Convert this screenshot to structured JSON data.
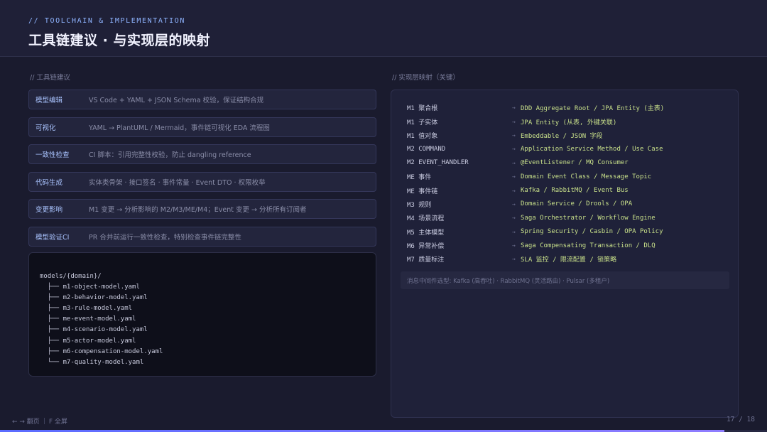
{
  "header": {
    "kicker": "// TOOLCHAIN & IMPLEMENTATION",
    "title": "工具链建议 · 与实现层的映射"
  },
  "left_section_label": "//  工具链建议",
  "right_section_label": "//  实现层映射（关键）",
  "tools": [
    {
      "name": "模型编辑",
      "desc": "VS Code + YAML + JSON Schema 校验，保证结构合规"
    },
    {
      "name": "可视化",
      "desc": "YAML → PlantUML / Mermaid，事件链可视化 EDA 流程图"
    },
    {
      "name": "一致性检查",
      "desc": "CI 脚本：引用完整性校验，防止 dangling reference"
    },
    {
      "name": "代码生成",
      "desc": "实体类骨架 · 接口签名 · 事件常量 · Event DTO · 权限枚举"
    },
    {
      "name": "变更影响",
      "desc": "M1 变更 → 分析影响的 M2/M3/ME/M4；Event 变更 → 分析所有订阅者"
    },
    {
      "name": "模型验证CI",
      "desc": "PR 合并前运行一致性检查，特别检查事件链完整性"
    }
  ],
  "code_lines": [
    "models/{domain}/",
    "  ├── m1-object-model.yaml",
    "  ├── m2-behavior-model.yaml",
    "  ├── m3-rule-model.yaml",
    "  ├── me-event-model.yaml",
    "  ├── m4-scenario-model.yaml",
    "  ├── m5-actor-model.yaml",
    "  ├── m6-compensation-model.yaml",
    "  └── m7-quality-model.yaml"
  ],
  "mappings": [
    {
      "src": "M1 聚合根",
      "dst": "DDD Aggregate Root / JPA Entity (主表)"
    },
    {
      "src": "M1 子实体",
      "dst": "JPA Entity (从表, 外键关联)"
    },
    {
      "src": "M1 值对象",
      "dst": "Embeddable / JSON 字段"
    },
    {
      "src": "M2 COMMAND",
      "dst": "Application Service Method / Use Case"
    },
    {
      "src": "M2 EVENT_HANDLER",
      "dst": "@EventListener / MQ Consumer"
    },
    {
      "src": "ME 事件",
      "dst": "Domain Event Class / Message Topic"
    },
    {
      "src": "ME 事件链",
      "dst": "Kafka / RabbitMQ / Event Bus"
    },
    {
      "src": "M3 规则",
      "dst": "Domain Service / Drools / OPA"
    },
    {
      "src": "M4 场景流程",
      "dst": "Saga Orchestrator / Workflow Engine"
    },
    {
      "src": "M5 主体模型",
      "dst": "Spring Security / Casbin / OPA Policy"
    },
    {
      "src": "M6 异常补偿",
      "dst": "Saga Compensating Transaction / DLQ"
    },
    {
      "src": "M7 质量标注",
      "dst": "SLA 监控 / 限流配置 / 锁策略"
    }
  ],
  "arrow_glyph": "→",
  "mapping_note": "消息中间件选型: Kafka (高吞吐) · RabbitMQ (灵活路由) · Pulsar (多租户)",
  "footer": {
    "nav_hint": "← → 翻页",
    "fullscreen_hint": "F 全屏",
    "page_indicator": "17 / 18"
  },
  "progress": {
    "current": 17,
    "total": 18
  }
}
